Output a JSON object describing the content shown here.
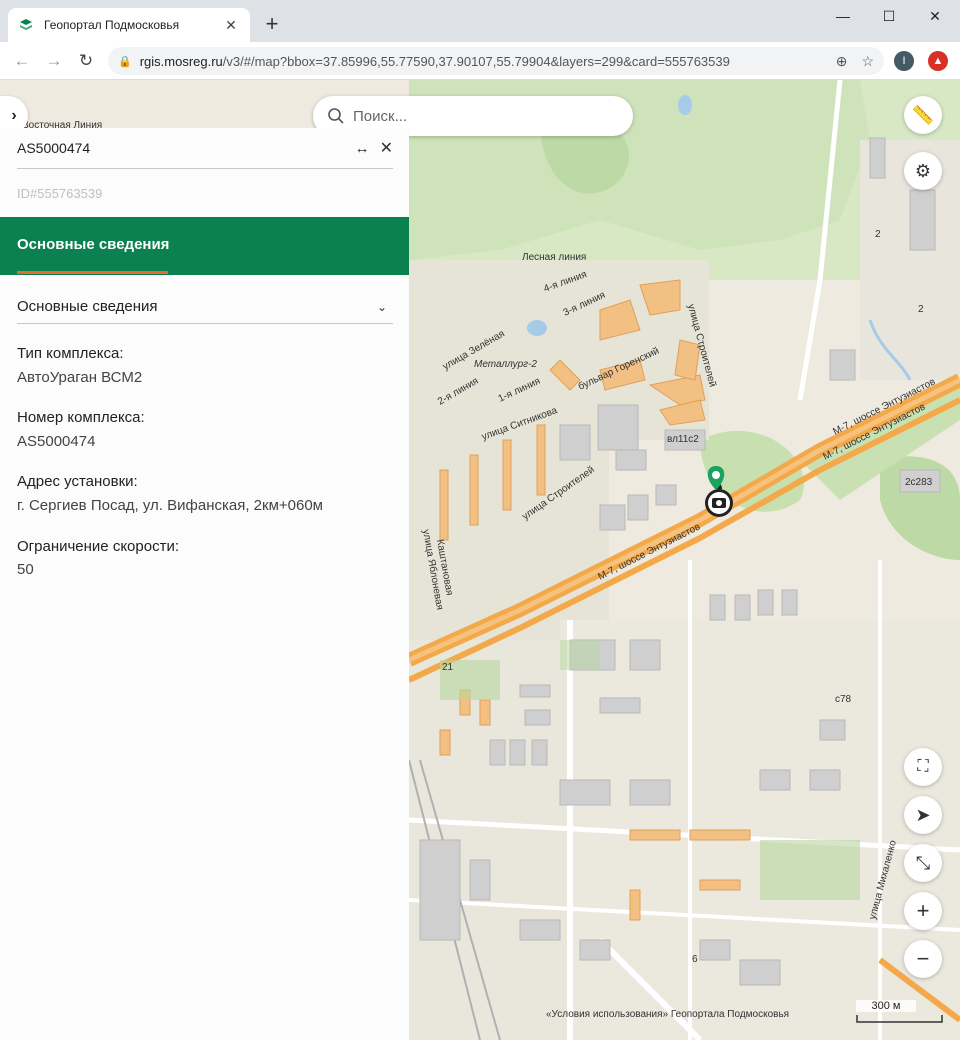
{
  "browser": {
    "tab_title": "Геопортал Подмосковья",
    "new_tab": "+",
    "close_tab": "✕",
    "url_host": "rgis.mosreg.ru",
    "url_path": "/v3/#/map?bbox=37.85996,55.77590,37.90107,55.79904&layers=299&card=555763539",
    "profile_letter": "I"
  },
  "map": {
    "search_placeholder": "Поиск...",
    "attribution": "«Условия использования» Геопортала Подмосковья",
    "scale_label": "300 м",
    "labels": {
      "vostochnaya": "Восточная Линия",
      "lesnaya": "Лесная линия",
      "line4": "4-я линия",
      "line3": "3-я линия",
      "zelenaya": "улица Зелёная",
      "metallurg": "Металлург-2",
      "line2": "2-я линия",
      "line1": "1-я линия",
      "bulvar": "бульвар Горенский",
      "sitnikova": "улица Ситникова",
      "stroiteley1": "улица Строителей",
      "stroiteley2": "улица Строителей",
      "entuziastov1": "М-7, шоссе Энтузиастов",
      "entuziastov2": "М-7, шоссе Энтузиастов",
      "entuziastov3": "М-7, шоссе Энтузиастов",
      "yablonevaya": "улица Яблоневая",
      "kashtanovaya": "Каштановая",
      "mikhalenko": "улица Михаленко",
      "house_vl11c2": "вл11с2",
      "house_2c283": "2с283",
      "house_2a": "2",
      "house_2b": "2",
      "house_21": "21",
      "house_6": "6",
      "house_c78": "с78"
    }
  },
  "panel": {
    "title": "AS5000474",
    "id_text": "ID#555763539",
    "section_tab": "Основные сведения",
    "dropdown": "Основные сведения",
    "fields": [
      {
        "label": "Тип комплекса:",
        "value": "АвтоУраган ВСМ2"
      },
      {
        "label": "Номер комплекса:",
        "value": "AS5000474"
      },
      {
        "label": "Адрес установки:",
        "value": "г. Сергиев Посад, ул. Вифанская, 2км+060м"
      },
      {
        "label": "Ограничение скорости:",
        "value": "50"
      }
    ]
  },
  "colors": {
    "brand_green": "#0b8150",
    "accent_orange": "#e46d2e",
    "road_orange": "#f3a94a"
  }
}
